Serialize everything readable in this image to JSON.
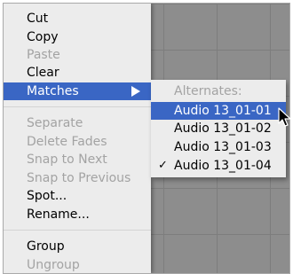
{
  "menu": {
    "items": [
      {
        "label": "Cut"
      },
      {
        "label": "Copy"
      },
      {
        "label": "Paste"
      },
      {
        "label": "Clear"
      },
      {
        "label": "Matches"
      },
      {
        "label": "Separate"
      },
      {
        "label": "Delete Fades"
      },
      {
        "label": "Snap to Next"
      },
      {
        "label": "Snap to Previous"
      },
      {
        "label": "Spot..."
      },
      {
        "label": "Rename..."
      },
      {
        "label": "Group"
      },
      {
        "label": "Ungroup"
      }
    ]
  },
  "submenu": {
    "header": "Alternates:",
    "items": [
      {
        "label": "Audio 13_01-01"
      },
      {
        "label": "Audio 13_01-02"
      },
      {
        "label": "Audio 13_01-03"
      },
      {
        "label": "Audio 13_01-04"
      }
    ],
    "check_glyph": "✓"
  },
  "colors": {
    "highlight": "#3a66c4",
    "menu_background": "#ececec",
    "disabled_text": "#a3a3a3"
  },
  "icons": {
    "submenu_arrow": "triangle-right-icon",
    "check": "checkmark-icon",
    "cursor": "mouse-pointer-icon"
  }
}
